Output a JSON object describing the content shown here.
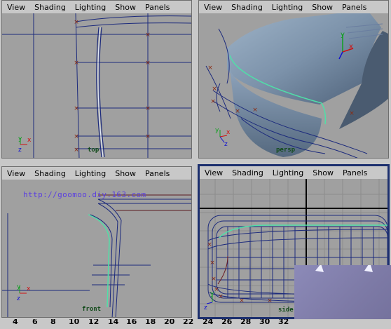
{
  "menu_labels": [
    "View",
    "Shading",
    "Lighting",
    "Show",
    "Panels"
  ],
  "viewports": {
    "top": {
      "camera": "top"
    },
    "persp": {
      "camera": "persp"
    },
    "front": {
      "camera": "front"
    },
    "side": {
      "camera": "side"
    }
  },
  "watermark": "http://goomoo.diy.163.com",
  "ruler_numbers": [
    "4",
    "6",
    "8",
    "10",
    "12",
    "14",
    "16",
    "18",
    "20",
    "22",
    "24",
    "26",
    "28",
    "30",
    "32"
  ],
  "colors": {
    "viewport_bg": "#a0a0a0",
    "menubar_bg": "#c8c8c8",
    "curve_blue": "#1c2a7c",
    "edit_point": "#8b2a10",
    "highlight_curve": "#4fe0a8",
    "active_border": "#1c2f6e",
    "axis_x": "#d01010",
    "axis_y": "#10a020",
    "axis_z": "#1010d0",
    "watermark": "#5b3fe0"
  },
  "icons": [
    "axis-gizmo-icon"
  ]
}
